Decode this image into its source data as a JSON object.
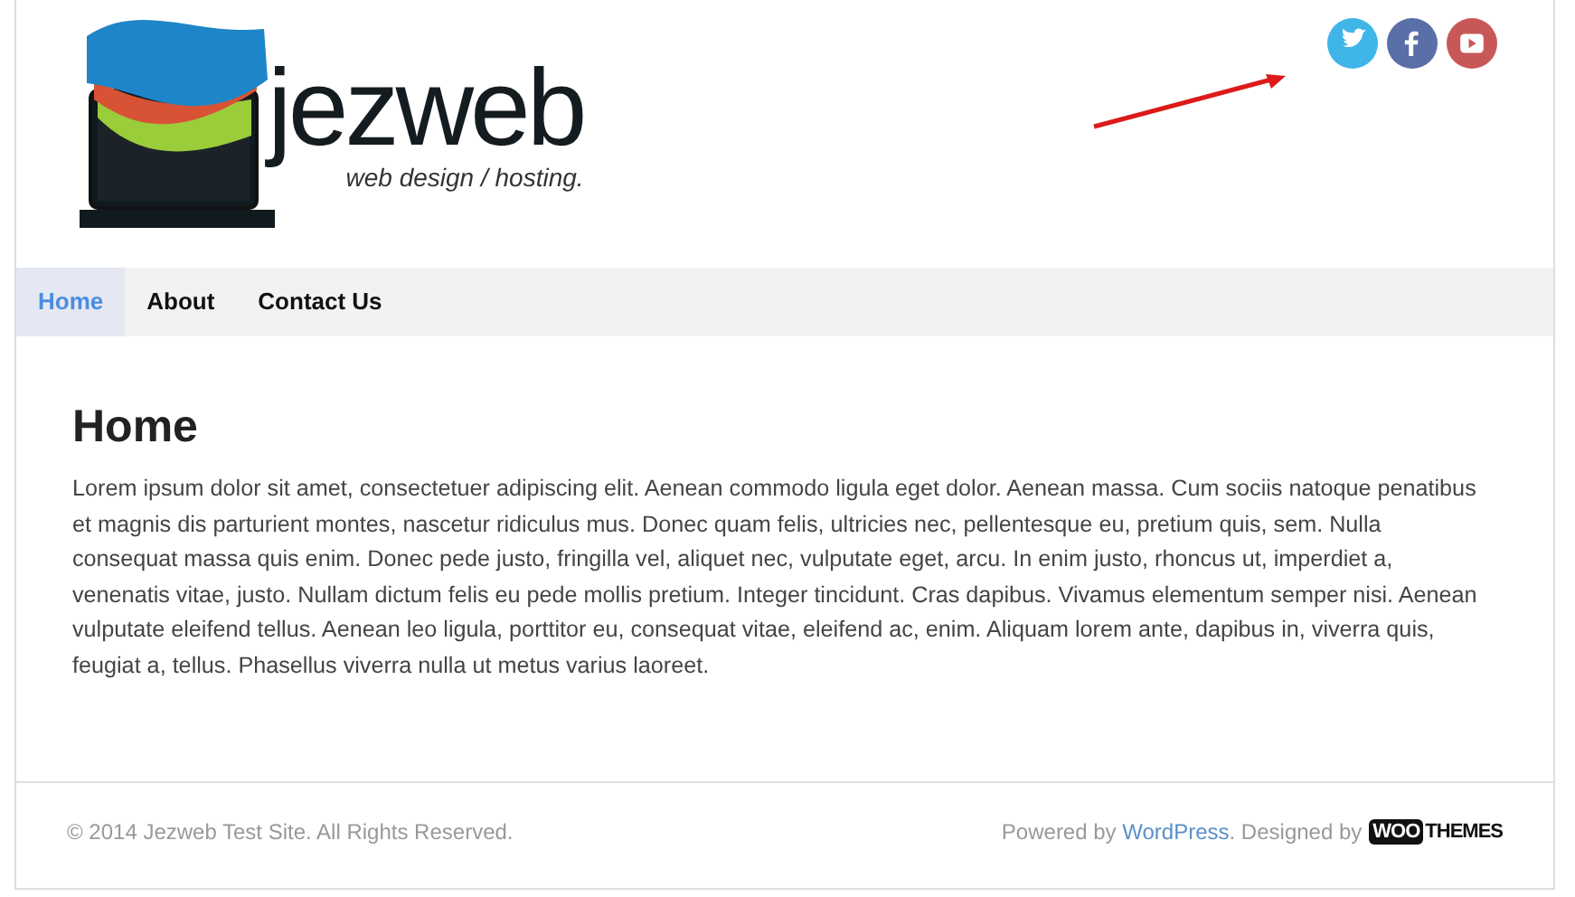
{
  "logo": {
    "name": "jezweb",
    "tagline": "web design / hosting."
  },
  "social": [
    {
      "kind": "twitter",
      "color": "#3fb5e8"
    },
    {
      "kind": "facebook",
      "color": "#5a6ea8"
    },
    {
      "kind": "youtube",
      "color": "#c85858"
    }
  ],
  "nav": [
    {
      "label": "Home",
      "selected": true
    },
    {
      "label": "About",
      "selected": false
    },
    {
      "label": "Contact Us",
      "selected": false
    }
  ],
  "page": {
    "title": "Home",
    "body": "Lorem ipsum dolor sit amet, consectetuer adipiscing elit. Aenean commodo ligula eget dolor. Aenean massa. Cum sociis natoque penatibus et magnis dis parturient montes, nascetur ridiculus mus. Donec quam felis, ultricies nec, pellentesque eu, pretium quis, sem. Nulla consequat massa quis enim. Donec pede justo, fringilla vel, aliquet nec, vulputate eget, arcu. In enim justo, rhoncus ut, imperdiet a, venenatis vitae, justo. Nullam dictum felis eu pede mollis pretium. Integer tincidunt. Cras dapibus. Vivamus elementum semper nisi. Aenean vulputate eleifend tellus. Aenean leo ligula, porttitor eu, consequat vitae, eleifend ac, enim. Aliquam lorem ante, dapibus in, viverra quis, feugiat a, tellus. Phasellus viverra nulla ut metus varius laoreet."
  },
  "footer": {
    "copyright": "© 2014 Jezweb Test Site. All Rights Reserved.",
    "powered_prefix": "Powered by ",
    "powered_link": "WordPress",
    "designed_by": ". Designed by",
    "woo_logo": {
      "mark": "WOO",
      "word": "THEMES"
    }
  }
}
